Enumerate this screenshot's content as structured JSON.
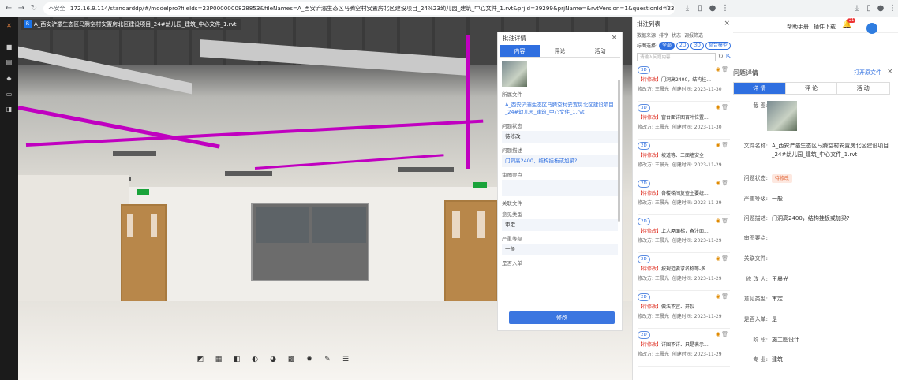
{
  "browser": {
    "insecure_label": "不安全",
    "url": "172.16.9.114/standarddp/#/modelpro?fileIds=23P0000000828853&fileNames=A_西安浐灞生态区马腾空村安置房北区建设项目_24%23幼儿园_建筑_中心文件_1.rvt&prjId=39299&prjName=&rvtVersion=1&questionId=23P0000..."
  },
  "viewer": {
    "file_tab": "A_西安浐灞生态区马腾空村安置房北区建设项目_24#幼儿园_建筑_中心文件_1.rvt",
    "file_icon": "R"
  },
  "detail": {
    "title": "批注详情",
    "tabs": [
      "内容",
      "评论",
      "活动"
    ],
    "fields": [
      {
        "label": "所属文件",
        "value": "A_西安浐灞生态区马腾空村安置房北区建设项目_24#幼儿园_建筑_中心文件_1.rvt"
      },
      {
        "label": "问题状态",
        "value": "待修改"
      },
      {
        "label": "问题描述",
        "value": "门洞高2400，结构挂板或加梁?"
      },
      {
        "label": "审图要点",
        "value": ""
      },
      {
        "label": "关联文件",
        "value": ""
      },
      {
        "label": "意见类型",
        "value": "审定"
      },
      {
        "label": "严重等级",
        "value": "一般"
      },
      {
        "label": "是否入单",
        "value": ""
      }
    ],
    "submit": "修改"
  },
  "list": {
    "title": "批注列表",
    "filters": [
      "数据来源",
      "排序",
      "状态",
      "调报筛选"
    ],
    "scope_label": "标图选择:",
    "scopes": [
      "全部",
      "2D",
      "3D",
      "整合模型"
    ],
    "search_placeholder": "请输入问题内容",
    "items": [
      {
        "tag": "3D",
        "status": "【待修改】",
        "text": "门洞高2400，结构挂...",
        "author": "修改方: 王晨光",
        "time": "创建时间: 2023-11-30"
      },
      {
        "tag": "3D",
        "status": "【待修改】",
        "text": "窗台面详图百叶位置...",
        "author": "修改方: 王晨光",
        "time": "创建时间: 2023-11-30"
      },
      {
        "tag": "2D",
        "status": "【待修改】",
        "text": "坡道等、三面墙安全",
        "author": "修改方: 王晨光",
        "time": "创建时间: 2023-11-29"
      },
      {
        "tag": "2D",
        "status": "【待修改】",
        "text": "各楼梯间复查主要统...",
        "author": "修改方: 王晨光",
        "time": "创建时间: 2023-11-29"
      },
      {
        "tag": "2D",
        "status": "【待修改】",
        "text": "上人屋面梯，备注面...",
        "author": "修改方: 王晨光",
        "time": "创建时间: 2023-11-29"
      },
      {
        "tag": "2D",
        "status": "【待修改】",
        "text": "按规范要求名称等-多...",
        "author": "修改方: 王晨光",
        "time": "创建时间: 2023-11-29"
      },
      {
        "tag": "2D",
        "status": "【待修改】",
        "text": "做法不宜、开裂",
        "author": "修改方: 王晨光",
        "time": "创建时间: 2023-11-29"
      },
      {
        "tag": "2D",
        "status": "【待修改】",
        "text": "详图不详、只是表示...",
        "author": "修改方: 王晨光",
        "time": "创建时间: 2023-11-29"
      }
    ]
  },
  "right": {
    "help": "帮助手册",
    "plugin": "插件下载",
    "badge": "21",
    "panel_title": "问题详情",
    "open_file": "打开原文件",
    "tabs": [
      "详 情",
      "评 论",
      "活 动"
    ],
    "rows": [
      {
        "k": "截 图:",
        "v": ""
      },
      {
        "k": "文件名称:",
        "v": "A_西安浐灞生态区马腾空村安置房北区建设项目_24#幼儿园_建筑_中心文件_1.rvt"
      },
      {
        "k": "问题状态:",
        "v": "待修改"
      },
      {
        "k": "严重等级:",
        "v": "一般"
      },
      {
        "k": "问题描述:",
        "v": "门洞高2400，结构挂板或加梁?"
      },
      {
        "k": "审图要点:",
        "v": ""
      },
      {
        "k": "关联文件:",
        "v": ""
      },
      {
        "k": "修 改 人:",
        "v": "王晨光"
      },
      {
        "k": "意见类型:",
        "v": "审定"
      },
      {
        "k": "是否入单:",
        "v": "是"
      },
      {
        "k": "阶 段:",
        "v": "施工图设计"
      },
      {
        "k": "专 业:",
        "v": "建筑"
      }
    ]
  }
}
